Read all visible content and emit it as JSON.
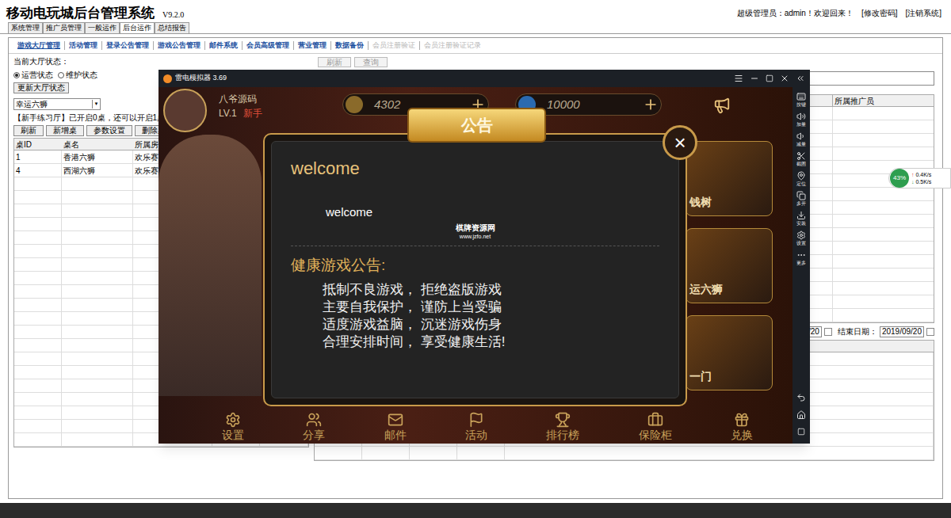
{
  "header": {
    "title": "移动电玩城后台管理系统",
    "version": "V9.2.0",
    "welcome": "超级管理员：admin！欢迎回来！",
    "links": [
      "[修改密码]",
      "[注销系统]"
    ]
  },
  "top_tabs": [
    {
      "label": "系统管理",
      "selected": false
    },
    {
      "label": "推广员管理",
      "selected": false
    },
    {
      "label": "一般运作",
      "selected": false
    },
    {
      "label": "后台运作",
      "selected": true
    },
    {
      "label": "总结报告",
      "selected": false
    }
  ],
  "sub_tabs": [
    {
      "label": "游戏大厅管理",
      "selected": true,
      "disabled": false
    },
    {
      "label": "活动管理",
      "selected": false,
      "disabled": false
    },
    {
      "label": "登录公告管理",
      "selected": false,
      "disabled": false
    },
    {
      "label": "游戏公告管理",
      "selected": false,
      "disabled": false
    },
    {
      "label": "邮件系统",
      "selected": false,
      "disabled": false
    },
    {
      "label": "会员高级管理",
      "selected": false,
      "disabled": false
    },
    {
      "label": "营业管理",
      "selected": false,
      "disabled": false
    },
    {
      "label": "数据备份",
      "selected": false,
      "disabled": false
    },
    {
      "label": "会员注册验证",
      "selected": false,
      "disabled": true
    },
    {
      "label": "会员注册验证记录",
      "selected": false,
      "disabled": true
    }
  ],
  "hall": {
    "status_label": "当前大厅状态：",
    "radios": [
      {
        "label": "运营状态",
        "selected": true
      },
      {
        "label": "维护状态",
        "selected": false
      }
    ],
    "update_button": "更新大厅状态",
    "game_select": "幸运六狮",
    "info": "【新手练习厅】已开启0桌，还可以开启1桌",
    "buttons": [
      "刷新",
      "新增桌",
      "参数设置",
      "删除桌"
    ]
  },
  "tables_list": {
    "columns": [
      "桌ID",
      "桌名",
      "所属房"
    ],
    "rows": [
      [
        "1",
        "香港六狮",
        "欢乐赛"
      ],
      [
        "4",
        "西湖六狮",
        "欢乐赛"
      ]
    ]
  },
  "right_panel": {
    "buttons": [
      "刷新",
      "查询"
    ],
    "columns": [
      "所属推广员"
    ],
    "date_start": "09/20",
    "end_label": "结束日期：",
    "date_end": "2019/09/20"
  },
  "emulator": {
    "title": "雷电模拟器 3.69",
    "sidebar": [
      "按键",
      "加量",
      "减量",
      "截图",
      "定位",
      "多开",
      "安装",
      "设置",
      "更多"
    ],
    "game": {
      "player": "八爷源码",
      "level": "LV.1",
      "rank": "新手",
      "coins": "4302",
      "gems": "10000",
      "side_cards": [
        "钱树",
        "运六狮",
        "一门"
      ],
      "bottom_menu": [
        "设置",
        "分享",
        "邮件",
        "活动",
        "排行榜",
        "保险柜",
        "兑换"
      ],
      "notice": {
        "banner": "公告",
        "close": "×",
        "headline": "welcome",
        "body": "welcome",
        "watermark": "棋牌资源网",
        "watermark_url": "www.jzfo.net",
        "section": "健康游戏公告:",
        "lines": [
          "抵制不良游戏， 拒绝盗版游戏",
          "主要自我保护， 谨防上当受骗",
          "适度游戏益脑， 沉迷游戏伤身",
          "合理安排时间， 享受健康生活!"
        ]
      }
    }
  },
  "net_widget": {
    "percent": "43%",
    "up": "0.4K/s",
    "down": "0.5K/s"
  }
}
